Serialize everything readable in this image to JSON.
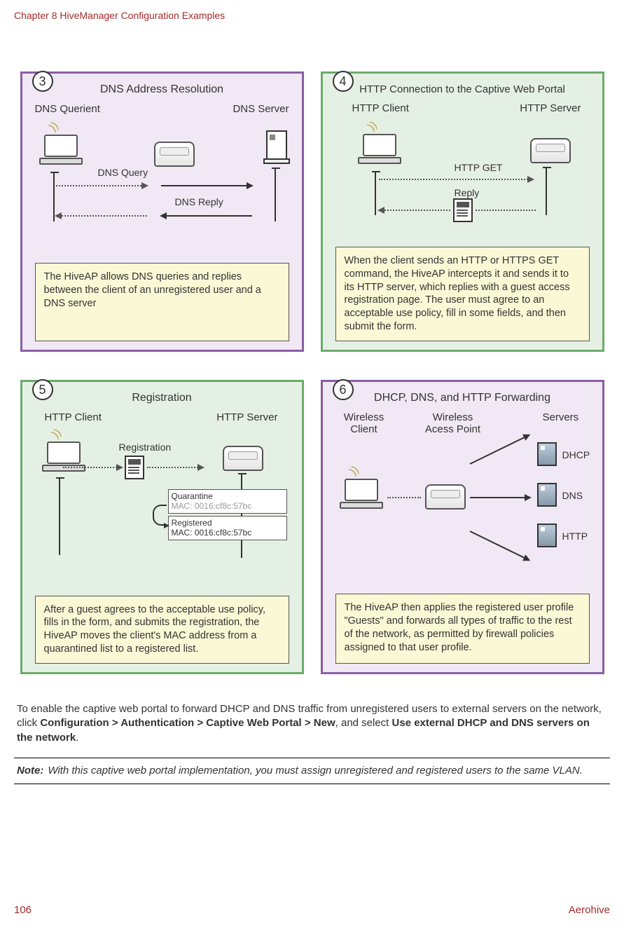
{
  "header": {
    "title": "Chapter 8 HiveManager Configuration Examples"
  },
  "footer": {
    "page": "106",
    "brand": "Aerohive"
  },
  "panels": {
    "p3": {
      "step": "3",
      "title": "DNS Address Resolution",
      "left_label": "DNS Querient",
      "right_label": "DNS Server",
      "arrow_top": "DNS Query",
      "arrow_bottom": "DNS Reply",
      "desc": "The HiveAP allows DNS queries and replies between the client of an unregistered user and a DNS server"
    },
    "p4": {
      "step": "4",
      "title": "HTTP Connection to the Captive Web Portal",
      "left_label": "HTTP Client",
      "right_label": "HTTP Server",
      "arrow_top": "HTTP GET",
      "arrow_bottom": "Reply",
      "desc": "When the client sends an HTTP or HTTPS GET command, the HiveAP intercepts it and sends it to its HTTP server, which replies with a guest access registration page. The user must agree to an acceptable use policy, fill in some fields, and then submit the form."
    },
    "p5": {
      "step": "5",
      "title": "Registration",
      "left_label": "HTTP Client",
      "right_label": "HTTP Server",
      "arrow_top": "Registration",
      "quarantine": {
        "label": "Quarantine",
        "mac": "MAC: 0016:cf8c:57bc"
      },
      "registered": {
        "label": "Registered",
        "mac": "MAC: 0016:cf8c:57bc"
      },
      "desc": "After a guest agrees to the acceptable use policy, fills in the form, and submits the registration, the HiveAP moves the client's MAC address from a quarantined list to a registered list."
    },
    "p6": {
      "step": "6",
      "title": "DHCP, DNS, and HTTP Forwarding",
      "col1": "Wireless\nClient",
      "col2": "Wireless\nAcess Point",
      "col3": "Servers",
      "server1": "DHCP",
      "server2": "DNS",
      "server3": "HTTP",
      "desc": "The HiveAP then applies the registered user profile \"Guests\" and forwards all types of traffic to the rest of the network, as permitted by firewall policies assigned to that user profile."
    }
  },
  "body_text": {
    "pre": "To enable the captive web portal to forward DHCP and DNS traffic from unregistered users to external servers on the network, click ",
    "bold1": "Configuration > Authentication > Captive Web Portal > New",
    "mid": ", and select ",
    "bold2": "Use external DHCP and DNS servers on the network",
    "post": "."
  },
  "note": {
    "label": "Note:",
    "text": "With this captive web portal implementation, you must assign unregistered and registered users to the same VLAN."
  }
}
